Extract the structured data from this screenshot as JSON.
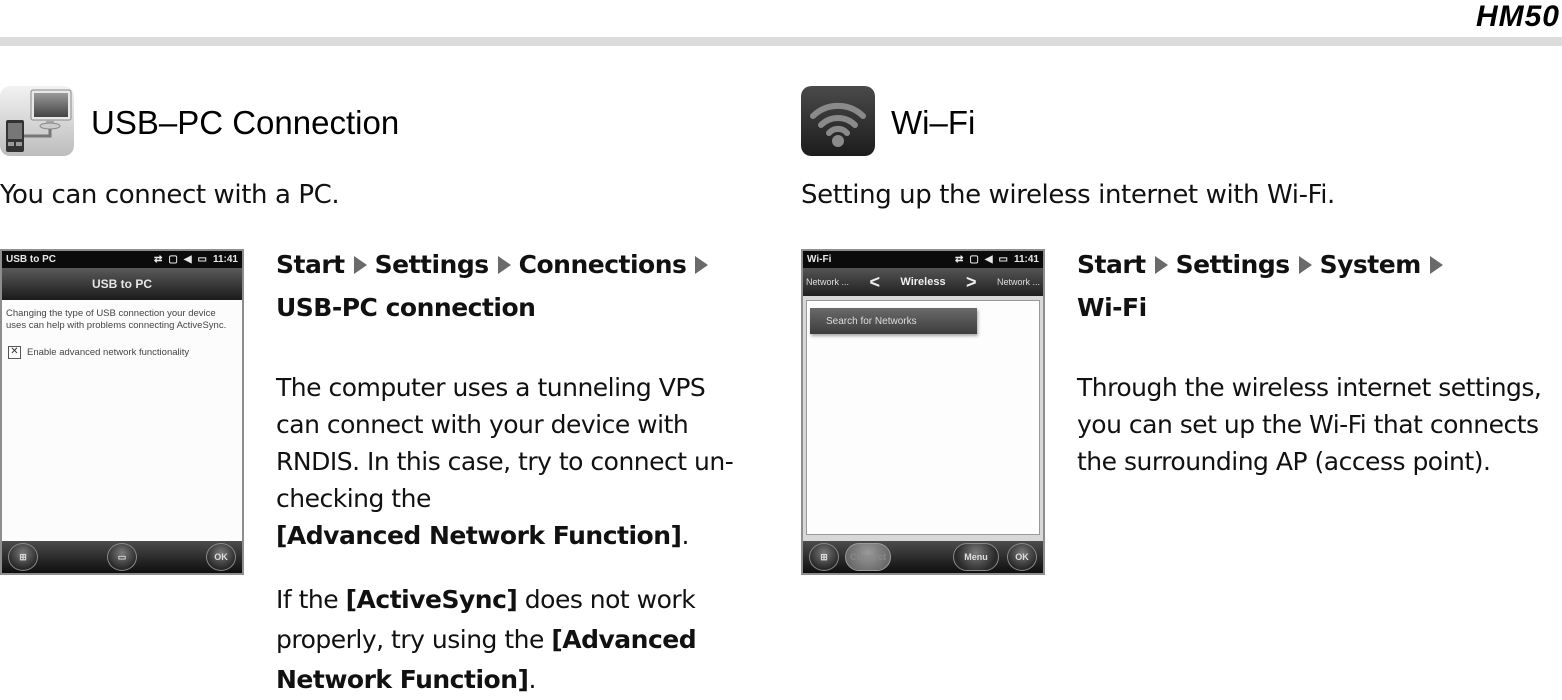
{
  "header": {
    "model": "HM50"
  },
  "left": {
    "icon": "usb-pc-connection-icon",
    "title": "USB–PC Connection",
    "intro": "You can connect with a PC.",
    "path": [
      "Start",
      "Settings",
      "Connections",
      "USB-PC connection"
    ],
    "screen": {
      "status_title": "USB to PC",
      "time": "11:41",
      "title": "USB to PC",
      "description": "Changing the type of USB connection your device uses can help with problems connecting ActiveSync.",
      "checkbox_label": "Enable advanced network functionality",
      "checkbox_checked": true,
      "softkeys": [
        "start",
        "keyboard",
        "OK"
      ]
    },
    "para1": {
      "text": "The computer uses a tunneling VPS can connect with your device with RNDIS. In this case, try to connect un-checking the ",
      "bold": "[Advanced Network Function]",
      "end": "."
    },
    "para2": {
      "t1": "If the ",
      "b1": "[ActiveSync]",
      "t2": " does not work properly, try using the ",
      "b2": "[Advanced Network Function]",
      "end": "."
    }
  },
  "right": {
    "icon": "wifi-icon",
    "title": "Wi–Fi",
    "intro": "Setting up the wireless internet with Wi-Fi.",
    "path": [
      "Start",
      "Settings",
      "System",
      "Wi-Fi"
    ],
    "screen": {
      "status_title": "Wi-Fi",
      "time": "11:41",
      "nav_prev": "Network ...",
      "nav_title": "Wireless",
      "nav_next": "Network ...",
      "search_button": "Search for Networks",
      "softkeys": [
        "start",
        "Connect",
        "Menu",
        "OK"
      ]
    },
    "para1": "Through the wireless internet settings, you can set up the Wi-Fi that connects the surrounding AP (access point)."
  }
}
